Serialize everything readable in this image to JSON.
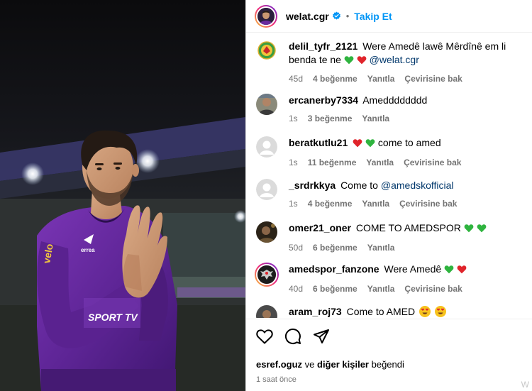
{
  "post": {
    "username": "welat.cgr",
    "follow_label": "Takip Et",
    "separator": "•"
  },
  "comments": [
    {
      "username": "delil_tyfr_2121",
      "text": "Were Amedê lawê Mêrdînê em li benda te ne",
      "emojis": [
        "green-heart",
        "red-heart"
      ],
      "mention": "@welat.cgr",
      "time": "45d",
      "likes": "4 beğenme",
      "reply": "Yanıtla",
      "translate": "Çevirisine bak",
      "avatar": "green-emblem"
    },
    {
      "username": "ercanerby7334",
      "text": "Amedddddddd",
      "time": "1s",
      "likes": "3 beğenme",
      "reply": "Yanıtla",
      "avatar": "photo-person"
    },
    {
      "username": "beratkutlu21",
      "text_before": "",
      "emojis_before": [
        "red-heart",
        "green-heart"
      ],
      "text": "come to amed",
      "time": "1s",
      "likes": "11 beğenme",
      "reply": "Yanıtla",
      "translate": "Çevirisine bak",
      "avatar": "default"
    },
    {
      "username": "_srdrkkya",
      "text": "Come to",
      "mention": "@amedskofficial",
      "time": "1s",
      "likes": "4 beğenme",
      "reply": "Yanıtla",
      "translate": "Çevirisine bak",
      "avatar": "default"
    },
    {
      "username": "omer21_oner",
      "text": "COME TO AMEDSPOR",
      "emojis": [
        "green-heart",
        "green-heart"
      ],
      "time": "50d",
      "likes": "6 beğenme",
      "reply": "Yanıtla",
      "avatar": "photo-dark"
    },
    {
      "username": "amedspor_fanzone",
      "text": "Were Amedê",
      "emojis": [
        "green-heart",
        "red-heart"
      ],
      "time": "40d",
      "likes": "6 beğenme",
      "reply": "Yanıtla",
      "translate": "Çevirisine bak",
      "avatar": "eagle-story"
    },
    {
      "username": "aram_roj73",
      "text": "Come to AMED",
      "emojis": [
        "heart-eyes",
        "heart-eyes"
      ],
      "avatar": "photo-person"
    }
  ],
  "actions": {
    "liked_by_user": "esref.oguz",
    "liked_by_mid": "ve",
    "liked_by_others": "diğer kişiler",
    "liked_by_suffix": "beğendi",
    "time": "1 saat önce"
  },
  "photo": {
    "jersey_text": "SPORT TV",
    "sponsor": "errea",
    "sleeve": "velo"
  },
  "colors": {
    "accent": "#0095f6",
    "jersey_purple": "#6a2a9e",
    "green_heart": "#2fb43f",
    "red_heart": "#e0242b"
  },
  "watermark": "W"
}
